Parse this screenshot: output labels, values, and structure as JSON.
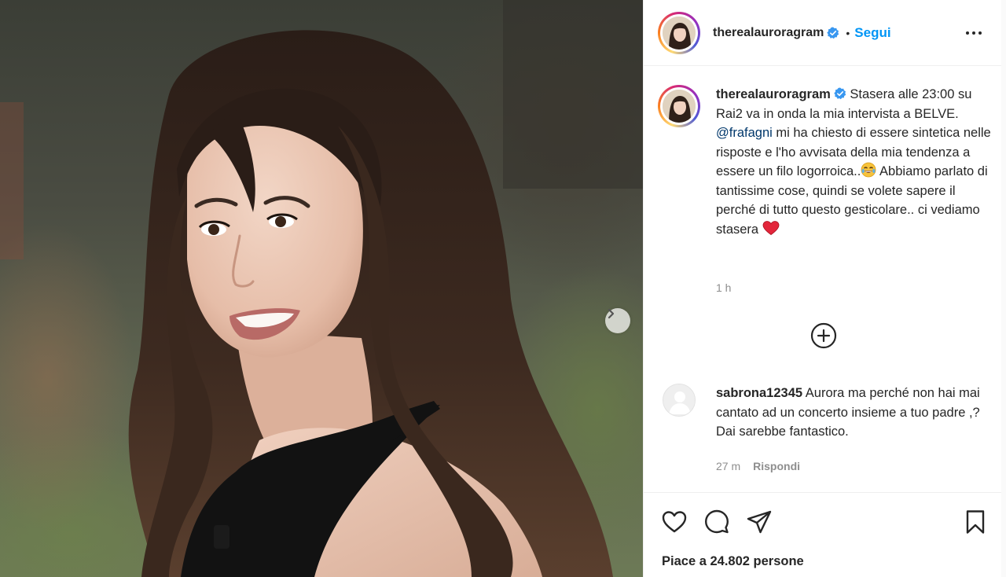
{
  "post": {
    "photo_alt": "",
    "next_label": "Avanti"
  },
  "header": {
    "username": "therealauroragram",
    "separator": "•",
    "follow_label": "Segui"
  },
  "caption": {
    "username": "therealauroragram",
    "text_part1": "Stasera alle 23:00 su Rai2 va in onda la mia intervista a BELVE.",
    "mention": "@frafagni",
    "text_part2": "mi ha chiesto di essere sintetica nelle risposte e l'ho avvisata della mia tendenza a essere un filo logorroica..",
    "text_part3": "Abbiamo parlato di tantissime cose, quindi se volete sapere il perché di tutto questo gesticolare.. ci vediamo stasera",
    "time": "1 h"
  },
  "comments": [
    {
      "username": "sabrona12345",
      "text": "Aurora ma perché non hai mai cantato ad un concerto insieme a tuo padre ,?Dai sarebbe fantastico.",
      "time": "27 m",
      "reply_label": "Rispondi"
    }
  ],
  "footer": {
    "likes_text": "Piace a 24.802 persone"
  },
  "icons": {
    "verified": "verified-badge-icon",
    "more": "more-options-icon",
    "add_comment": "plus-circle-icon",
    "like": "heart-icon",
    "comment": "comment-bubble-icon",
    "share": "paper-plane-icon",
    "save": "bookmark-icon",
    "next": "chevron-right-icon"
  },
  "colors": {
    "accent_blue": "#0095f6",
    "mention_blue": "#00376b",
    "verified_blue": "#3897f0",
    "heart_red": "#e3263b",
    "muted_gray": "#8e8e8e"
  }
}
